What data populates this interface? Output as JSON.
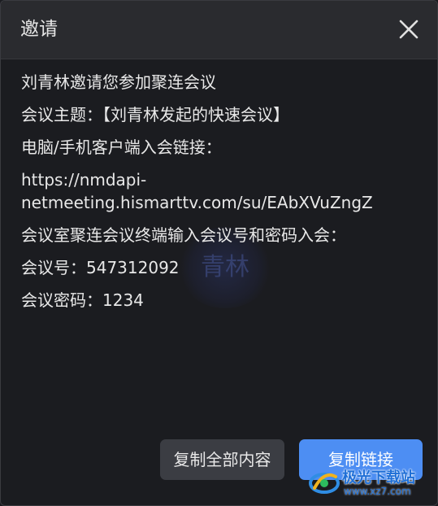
{
  "dialog": {
    "title": "邀请",
    "close_icon": "close-icon"
  },
  "content": {
    "lines": [
      "刘青林邀请您参加聚连会议",
      "会议主题：【刘青林发起的快速会议】",
      "电脑/手机客户端入会链接："
    ],
    "url_part1": "https://nmdapi-",
    "url_part2": "netmeeting.hismarttv.com/su/EAbXVuZngZ",
    "terminal_line": "会议室聚连会议终端输入会议号和密码入会：",
    "meeting_id": "会议号：547312092",
    "meeting_password": "会议密码：1234"
  },
  "watermark": {
    "text": "青林"
  },
  "buttons": {
    "copy_all": "复制全部内容",
    "copy_link": "复制链接"
  },
  "corner_logo": {
    "main": "极光下载站",
    "sub": "www.xz7.com"
  },
  "colors": {
    "background": "#1b1c20",
    "titlebar": "#2a2b2f",
    "primary_button": "#4d8ef3",
    "secondary_button": "#3b3d43"
  }
}
